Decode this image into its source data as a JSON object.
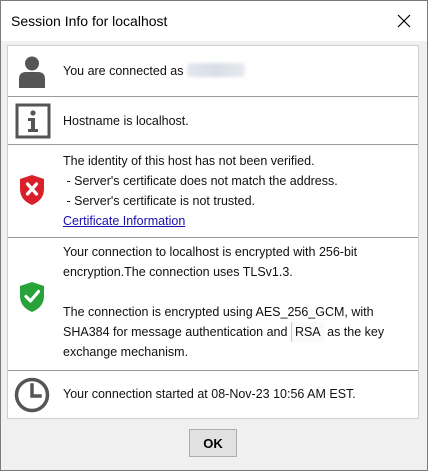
{
  "window": {
    "title": "Session Info for localhost",
    "close_icon": "close-icon"
  },
  "rows": {
    "user": {
      "icon": "person-icon",
      "prefix": "You are connected as"
    },
    "host": {
      "icon": "info-icon",
      "text": "Hostname is localhost."
    },
    "identity": {
      "icon": "red-shield-x-icon",
      "line1": "The identity of this host has not been verified.",
      "line2": " - Server's certificate does not match the address.",
      "line3": " - Server's certificate is not trusted.",
      "link": "Certificate Information"
    },
    "encryption": {
      "icon": "green-shield-check-icon",
      "line1": "Your connection to localhost is encrypted with 256-bit",
      "line2": "encryption.The connection uses TLSv1.3.",
      "line3": "The connection is encrypted using AES_256_GCM, with",
      "line4_pre": "SHA384 for message authentication and",
      "line4_code": "RSA",
      "line4_post": " as the key",
      "line5": "exchange mechanism."
    },
    "time": {
      "icon": "clock-icon",
      "text": "Your connection started at 08-Nov-23 10:56 AM EST."
    }
  },
  "buttons": {
    "ok": "OK"
  },
  "colors": {
    "link": "#1a0dab",
    "shield_red": "#d9202a",
    "shield_green": "#27a33a",
    "icon_gray": "#555555"
  }
}
